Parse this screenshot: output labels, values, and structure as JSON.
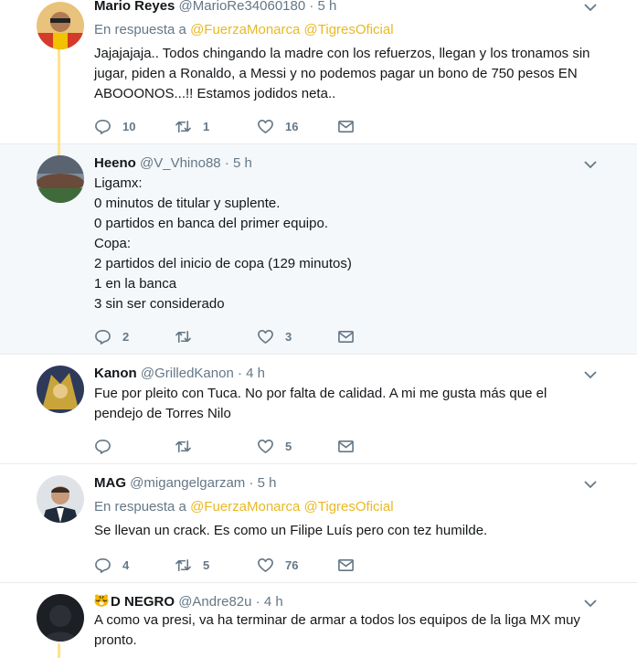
{
  "tweets": [
    {
      "name": "Mario Reyes",
      "handle": "@MarioRe34060180",
      "dot": "·",
      "time": "5 h",
      "reply_prefix": "En respuesta a",
      "reply_to_1": "@FuerzaMonarca",
      "reply_to_2": "@TigresOficial",
      "lines": [
        "Jajajajaja.. Todos chingando la madre con los refuerzos, llegan y los tronamos sin",
        "jugar, piden a Ronaldo, a Messi y no podemos pagar un bono de 750 pesos EN",
        "ABOOONOS...!! Estamos jodidos neta.."
      ],
      "replies": "10",
      "retweets": "1",
      "likes": "16"
    },
    {
      "name": "Heeno",
      "handle": "@V_Vhino88",
      "dot": "·",
      "time": "5 h",
      "lines": [
        "Ligamx:",
        "0 minutos de titular y suplente.",
        "0 partidos en banca del primer equipo.",
        "Copa:",
        "2 partidos del inicio de copa (129 minutos)",
        "1 en la banca",
        "3 sin ser considerado"
      ],
      "replies": "2",
      "retweets": "",
      "likes": "3"
    },
    {
      "name": "Kanon",
      "handle": "@GrilledKanon",
      "dot": "·",
      "time": "4 h",
      "lines": [
        "Fue por pleito con Tuca. No por falta de calidad. A mi me gusta más que el",
        "pendejo de Torres Nilo"
      ],
      "replies": "",
      "retweets": "",
      "likes": "5"
    },
    {
      "name": "MAG",
      "handle": "@migangelgarzam",
      "dot": "·",
      "time": "5 h",
      "reply_prefix": "En respuesta a",
      "reply_to_1": "@FuerzaMonarca",
      "reply_to_2": "@TigresOficial",
      "lines": [
        "Se llevan un crack. Es como un Filipe Luís pero con tez humilde."
      ],
      "replies": "4",
      "retweets": "5",
      "likes": "76"
    },
    {
      "name": "D NEGRO",
      "handle": "@Andre82u",
      "dot": "·",
      "time": "4 h",
      "lines": [
        "A como va presi, va ha terminar de armar a todos los equipos de la liga MX muy",
        "pronto."
      ]
    }
  ],
  "colors": {
    "accent": "#e8b923",
    "thread_line": "#ffe389",
    "muted": "#657786",
    "highlight_bg": "#f5f8fa"
  },
  "icons": [
    "reply-icon",
    "retweet-icon",
    "like-icon",
    "dm-icon",
    "chevron-down-icon",
    "tiger-emoji"
  ]
}
